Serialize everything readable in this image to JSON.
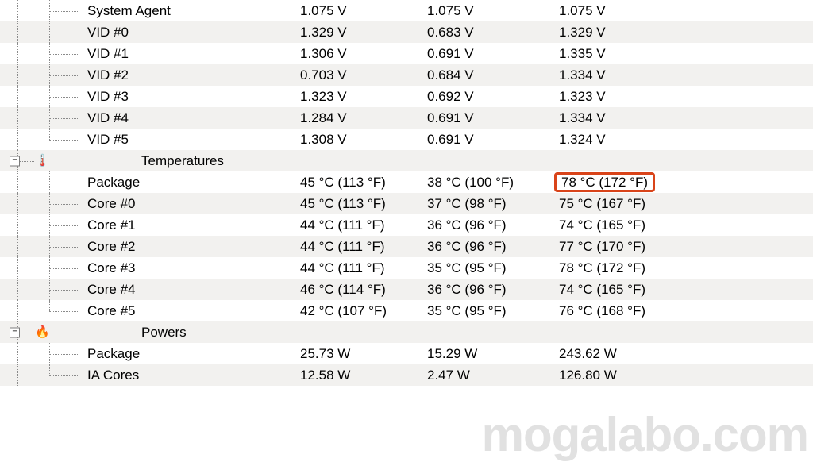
{
  "watermark": "mogalabo.com",
  "sections": [
    {
      "kind": "rows",
      "rows": [
        {
          "label": "System Agent",
          "v1": "1.075 V",
          "v2": "1.075 V",
          "v3": "1.075 V"
        },
        {
          "label": "VID #0",
          "v1": "1.329 V",
          "v2": "0.683 V",
          "v3": "1.329 V"
        },
        {
          "label": "VID #1",
          "v1": "1.306 V",
          "v2": "0.691 V",
          "v3": "1.335 V"
        },
        {
          "label": "VID #2",
          "v1": "0.703 V",
          "v2": "0.684 V",
          "v3": "1.334 V"
        },
        {
          "label": "VID #3",
          "v1": "1.323 V",
          "v2": "0.692 V",
          "v3": "1.323 V"
        },
        {
          "label": "VID #4",
          "v1": "1.284 V",
          "v2": "0.691 V",
          "v3": "1.334 V"
        },
        {
          "label": "VID #5",
          "v1": "1.308 V",
          "v2": "0.691 V",
          "v3": "1.324 V"
        }
      ]
    },
    {
      "kind": "header",
      "icon": "thermometer-icon",
      "glyph": "🌡️",
      "label": "Temperatures"
    },
    {
      "kind": "rows",
      "rows": [
        {
          "label": "Package",
          "v1": "45 °C  (113 °F)",
          "v2": "38 °C  (100 °F)",
          "v3": "78 °C  (172 °F)",
          "highlight": true
        },
        {
          "label": "Core #0",
          "v1": "45 °C  (113 °F)",
          "v2": "37 °C  (98 °F)",
          "v3": "75 °C  (167 °F)"
        },
        {
          "label": "Core #1",
          "v1": "44 °C  (111 °F)",
          "v2": "36 °C  (96 °F)",
          "v3": "74 °C  (165 °F)"
        },
        {
          "label": "Core #2",
          "v1": "44 °C  (111 °F)",
          "v2": "36 °C  (96 °F)",
          "v3": "77 °C  (170 °F)"
        },
        {
          "label": "Core #3",
          "v1": "44 °C  (111 °F)",
          "v2": "35 °C  (95 °F)",
          "v3": "78 °C  (172 °F)"
        },
        {
          "label": "Core #4",
          "v1": "46 °C  (114 °F)",
          "v2": "36 °C  (96 °F)",
          "v3": "74 °C  (165 °F)"
        },
        {
          "label": "Core #5",
          "v1": "42 °C  (107 °F)",
          "v2": "35 °C  (95 °F)",
          "v3": "76 °C  (168 °F)"
        }
      ]
    },
    {
      "kind": "header",
      "icon": "fire-icon",
      "glyph": "🔥",
      "label": "Powers"
    },
    {
      "kind": "rows",
      "rows": [
        {
          "label": "Package",
          "v1": "25.73 W",
          "v2": "15.29 W",
          "v3": "243.62 W"
        },
        {
          "label": "IA Cores",
          "v1": "12.58 W",
          "v2": "2.47 W",
          "v3": "126.80 W"
        }
      ]
    }
  ]
}
